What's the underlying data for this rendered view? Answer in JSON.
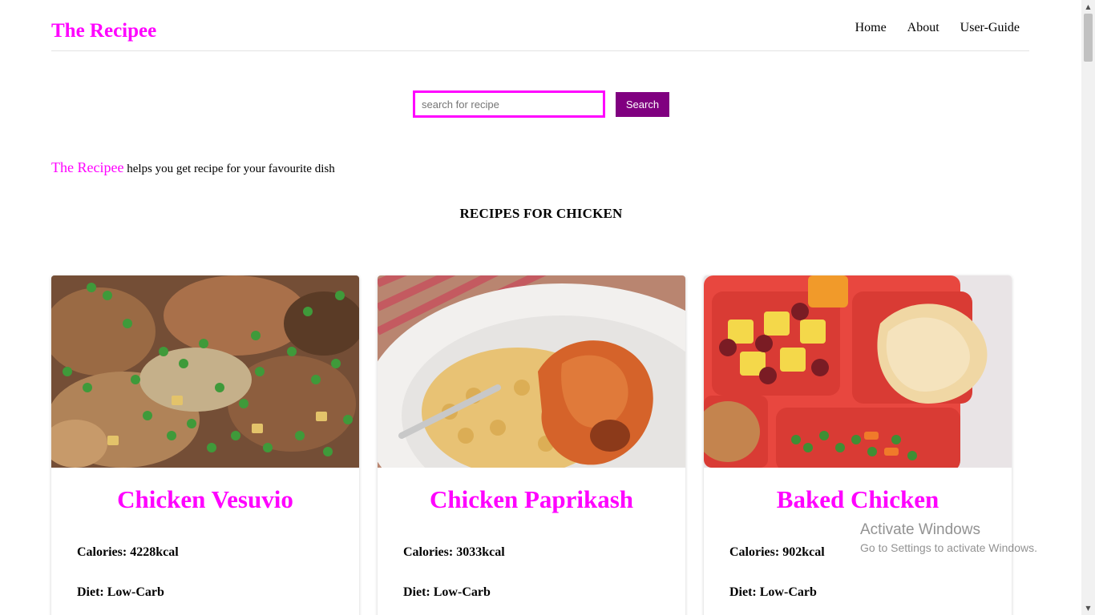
{
  "header": {
    "brand": "The Recipee",
    "nav": [
      "Home",
      "About",
      "User-Guide"
    ]
  },
  "search": {
    "placeholder": "search for recipe",
    "value": "",
    "button_label": "Search"
  },
  "tagline": {
    "brand": "The Recipee",
    "text": " helps you get recipe for your favourite dish"
  },
  "section": {
    "heading": "RECIPES FOR CHICKEN"
  },
  "recipes": [
    {
      "title": "Chicken Vesuvio",
      "calories": "Calories: 4228kcal",
      "diet": "Diet: Low-Carb"
    },
    {
      "title": "Chicken Paprikash",
      "calories": "Calories: 3033kcal",
      "diet": "Diet: Low-Carb"
    },
    {
      "title": "Baked Chicken",
      "calories": "Calories: 902kcal",
      "diet": "Diet: Low-Carb"
    }
  ],
  "watermark": {
    "title": "Activate Windows",
    "subtitle": "Go to Settings to activate Windows."
  },
  "colors": {
    "brand": "#ff00ff",
    "button": "#800080"
  }
}
